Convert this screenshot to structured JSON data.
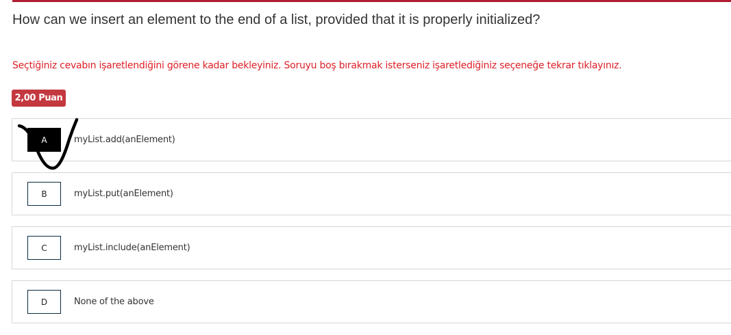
{
  "question": {
    "text": "How can we insert an element to the end of a list, provided that it is properly initialized?"
  },
  "instruction": {
    "text": "Seçtiğiniz cevabın işaretlendiğini görene kadar bekleyiniz. Soruyu boş bırakmak isterseniz işaretlediğiniz seçeneğe tekrar tıklayınız."
  },
  "points": {
    "label": "2,00 Puan",
    "color": "#c4383f"
  },
  "options": [
    {
      "key": "A",
      "text": "myList.add(anElement)",
      "selected": true
    },
    {
      "key": "B",
      "text": "myList.put(anElement)",
      "selected": false
    },
    {
      "key": "C",
      "text": "myList.include(anElement)",
      "selected": false
    },
    {
      "key": "D",
      "text": "None of the above",
      "selected": false
    }
  ],
  "annotation": {
    "icon": "handwritten-check-mark-icon",
    "color": "#000000"
  },
  "colors": {
    "accent": "#b01e34",
    "instruction": "#dd1f26",
    "selected_key_bg": "#000000"
  }
}
